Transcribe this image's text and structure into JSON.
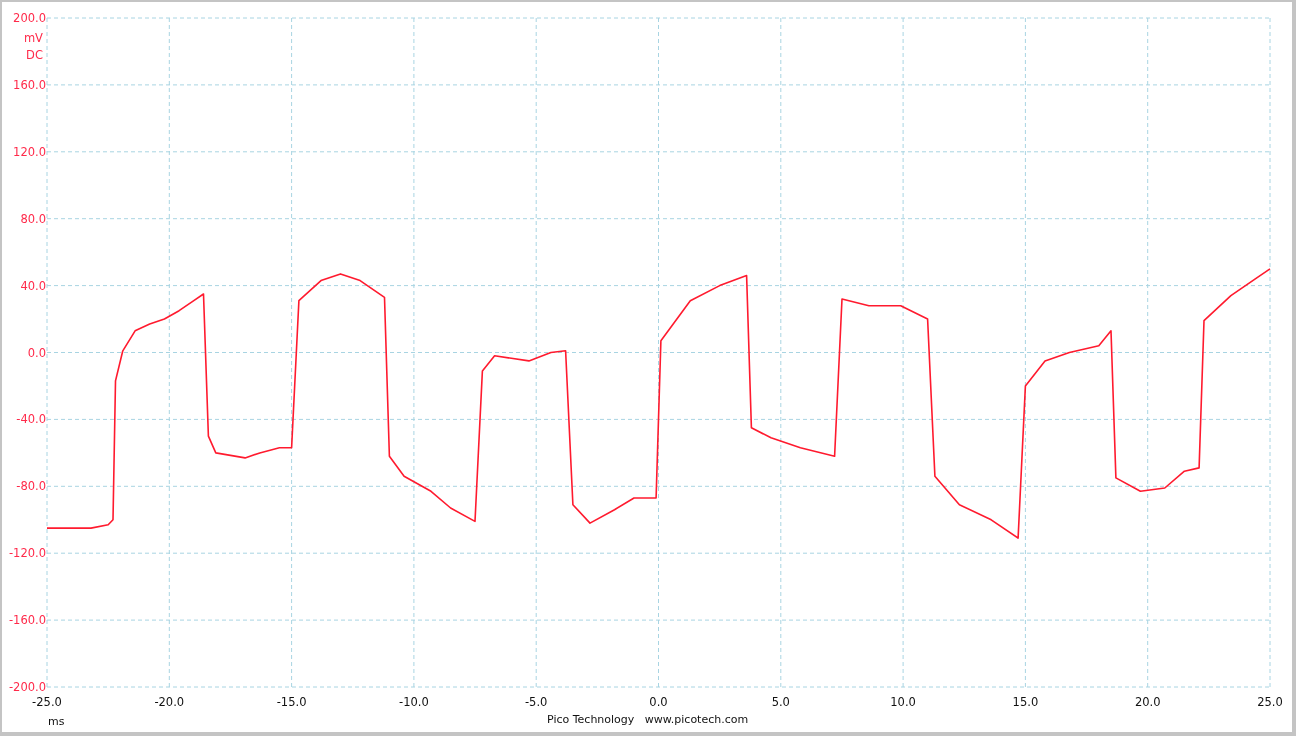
{
  "chart": {
    "coupling": "DC",
    "footer": {
      "company": "Pico Technology",
      "website": "www.picotech.com"
    },
    "chart_data": {
      "type": "line",
      "grid": true,
      "xlabel": "ms",
      "ylabel": "mV",
      "xlim": [
        -25,
        25
      ],
      "ylim": [
        -200,
        200
      ],
      "xticks": [
        {
          "value": -25,
          "label": "-25.0"
        },
        {
          "value": -20,
          "label": "-20.0"
        },
        {
          "value": -15,
          "label": "-15.0"
        },
        {
          "value": -10,
          "label": "-10.0"
        },
        {
          "value": -5,
          "label": "-5.0"
        },
        {
          "value": 0,
          "label": "0.0"
        },
        {
          "value": 5,
          "label": "5.0"
        },
        {
          "value": 10,
          "label": "10.0"
        },
        {
          "value": 15,
          "label": "15.0"
        },
        {
          "value": 20,
          "label": "20.0"
        },
        {
          "value": 25,
          "label": "25.0"
        }
      ],
      "yticks": [
        {
          "value": 200,
          "label": "200.0"
        },
        {
          "value": 160,
          "label": "160.0"
        },
        {
          "value": 120,
          "label": "120.0"
        },
        {
          "value": 80,
          "label": "80.0"
        },
        {
          "value": 40,
          "label": "40.0"
        },
        {
          "value": 0,
          "label": "0.0"
        },
        {
          "value": -40,
          "label": "-40.0"
        },
        {
          "value": -80,
          "label": "-80.0"
        },
        {
          "value": -120,
          "label": "-120.0"
        },
        {
          "value": -160,
          "label": "-160.0"
        },
        {
          "value": -200,
          "label": "-200.0"
        }
      ],
      "x": [
        -25,
        -23.2,
        -22.5,
        -22.3,
        -22.2,
        -21.9,
        -21.4,
        -20.8,
        -20.2,
        -19.6,
        -19.0,
        -18.6,
        -18.4,
        -18.1,
        -16.9,
        -16.3,
        -15.5,
        -15.0,
        -14.7,
        -13.8,
        -13.0,
        -12.2,
        -11.2,
        -11.0,
        -10.4,
        -9.3,
        -8.5,
        -7.5,
        -7.2,
        -6.7,
        -5.3,
        -4.4,
        -3.8,
        -3.5,
        -2.8,
        -1.8,
        -1.0,
        -0.1,
        0.1,
        1.3,
        2.5,
        3.6,
        3.8,
        4.6,
        5.8,
        7.2,
        7.5,
        8.6,
        9.9,
        11.0,
        11.3,
        12.3,
        13.6,
        14.7,
        15.0,
        15.8,
        16.8,
        18.0,
        18.5,
        18.7,
        19.7,
        20.7,
        21.5,
        22.1,
        22.3,
        23.4,
        24.4,
        25
      ],
      "series": [
        {
          "color": "#ff1a2e",
          "values": [
            -105,
            -105,
            -103,
            -100,
            -17,
            1,
            13,
            17,
            20,
            25,
            31,
            35,
            -50,
            -60,
            -63,
            -60,
            -57,
            -57,
            31,
            43,
            47,
            43,
            33,
            -62,
            -74,
            -83,
            -93,
            -101,
            -11,
            -2,
            -5,
            0,
            1,
            -91,
            -102,
            -94,
            -87,
            -87,
            7,
            31,
            40,
            46,
            -45,
            -51,
            -57,
            -62,
            32,
            28,
            28,
            20,
            -74,
            -91,
            -100,
            -111,
            -20,
            -5,
            0,
            4,
            13,
            -75,
            -83,
            -81,
            -71,
            -69,
            19,
            34,
            44,
            50
          ]
        }
      ]
    }
  }
}
